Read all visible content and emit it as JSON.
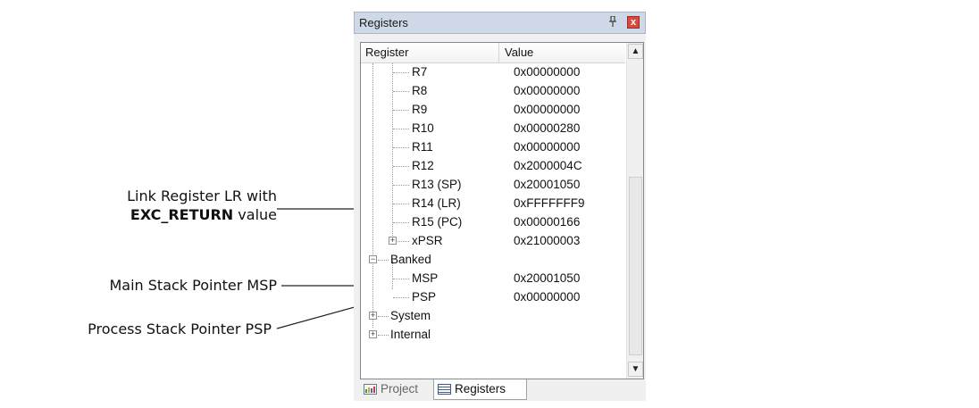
{
  "panel": {
    "title": "Registers",
    "pin_glyph": "✵",
    "close_glyph": "x"
  },
  "columns": {
    "register": "Register",
    "value": "Value"
  },
  "rows": [
    {
      "name": "R7",
      "value": "0x00000000"
    },
    {
      "name": "R8",
      "value": "0x00000000"
    },
    {
      "name": "R9",
      "value": "0x00000000"
    },
    {
      "name": "R10",
      "value": "0x00000280"
    },
    {
      "name": "R11",
      "value": "0x00000000"
    },
    {
      "name": "R12",
      "value": "0x2000004C"
    },
    {
      "name": "R13 (SP)",
      "value": "0x20001050"
    },
    {
      "name": "R14 (LR)",
      "value": "0xFFFFFFF9"
    },
    {
      "name": "R15 (PC)",
      "value": "0x00000166"
    },
    {
      "name": "xPSR",
      "value": "0x21000003",
      "expander": "+"
    },
    {
      "name": "Banked",
      "value": "",
      "expander": "−"
    },
    {
      "name": "MSP",
      "value": "0x20001050"
    },
    {
      "name": "PSP",
      "value": "0x00000000"
    },
    {
      "name": "System",
      "value": "",
      "expander": "+"
    },
    {
      "name": "Internal",
      "value": "",
      "expander": "+"
    }
  ],
  "tabs": {
    "project": "Project",
    "registers": "Registers"
  },
  "annotations": {
    "lr_line1": "Link Register LR with",
    "lr_bold": "EXC_RETURN",
    "lr_rest": " value",
    "msp": "Main Stack Pointer MSP",
    "psp": "Process Stack Pointer PSP"
  },
  "colors": {
    "title_bar": "#cfd8e6",
    "close_button": "#d94a3d",
    "grid_lines": "#9a9a9a"
  }
}
